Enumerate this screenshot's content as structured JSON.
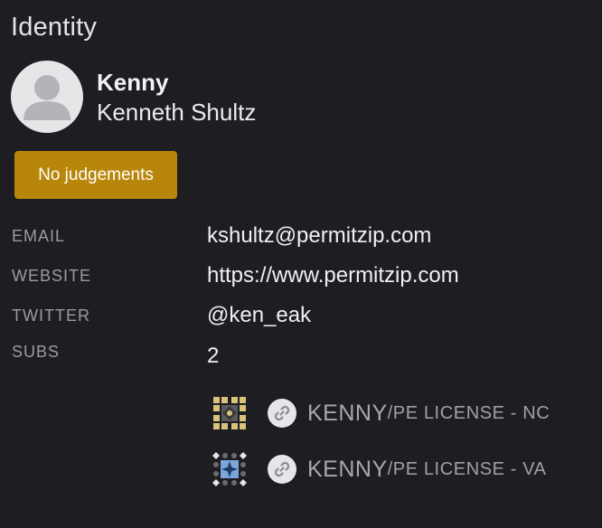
{
  "section": {
    "title": "Identity"
  },
  "profile": {
    "nickname": "Kenny",
    "full_name": "Kenneth Shultz",
    "avatar_icon": "user-placeholder-icon"
  },
  "badge": {
    "label": "No judgements",
    "color": "#b8860b"
  },
  "fields": {
    "email": {
      "label": "EMAIL",
      "value": "kshultz@permitzip.com"
    },
    "website": {
      "label": "WEBSITE",
      "value": "https://www.permitzip.com"
    },
    "twitter": {
      "label": "TWITTER",
      "value": "@ken_eak"
    },
    "subs": {
      "label": "SUBS",
      "value": "2"
    }
  },
  "subscriptions": [
    {
      "owner": "KENNY",
      "repo": "/PE LICENSE - NC",
      "icon": "link-icon",
      "accent": "#d9c27a"
    },
    {
      "owner": "KENNY",
      "repo": "/PE LICENSE - VA",
      "icon": "link-icon",
      "accent": "#7aa6d9"
    }
  ]
}
